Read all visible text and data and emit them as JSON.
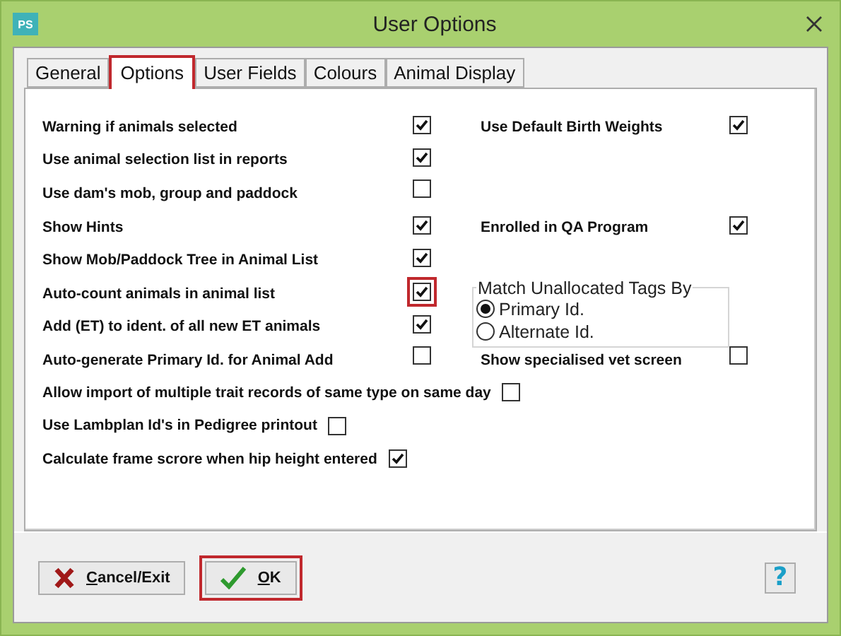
{
  "window": {
    "title": "User Options",
    "app_icon": "PS"
  },
  "tabs": [
    {
      "label": "General",
      "selected": false,
      "highlighted": false
    },
    {
      "label": "Options",
      "selected": true,
      "highlighted": true
    },
    {
      "label": "User Fields",
      "selected": false,
      "highlighted": false
    },
    {
      "label": "Colours",
      "selected": false,
      "highlighted": false
    },
    {
      "label": "Animal Display",
      "selected": false,
      "highlighted": false
    }
  ],
  "options": [
    {
      "kind": "left",
      "label": "Warning if animals selected",
      "checked": true,
      "highlighted": false
    },
    {
      "kind": "right",
      "label": "Use Default Birth Weights",
      "checked": true,
      "highlighted": false
    },
    {
      "kind": "left",
      "label": "Use animal selection list in reports",
      "checked": true,
      "highlighted": false
    },
    {
      "kind": "left",
      "label": "Use dam's mob, group and paddock",
      "checked": false,
      "highlighted": false
    },
    {
      "kind": "left",
      "label": "Show Hints",
      "checked": true,
      "highlighted": false
    },
    {
      "kind": "right",
      "label": "Enrolled in QA Program",
      "checked": true,
      "highlighted": false
    },
    {
      "kind": "left",
      "label": "Show Mob/Paddock Tree in Animal List",
      "checked": true,
      "highlighted": false
    },
    {
      "kind": "left",
      "label": "Auto-count animals in animal list",
      "checked": true,
      "highlighted": true
    },
    {
      "kind": "left",
      "label": "Add (ET) to ident. of all new ET animals",
      "checked": true,
      "highlighted": false
    },
    {
      "kind": "left",
      "label": "Auto-generate Primary Id. for Animal Add",
      "checked": false,
      "highlighted": false
    },
    {
      "kind": "right",
      "label": "Show specialised vet screen",
      "checked": false,
      "highlighted": false
    },
    {
      "kind": "wide",
      "label": "Allow import of multiple trait records of same type on same day",
      "checked": false,
      "highlighted": false
    },
    {
      "kind": "wide",
      "label": "Use Lambplan Id's in Pedigree printout",
      "checked": false,
      "highlighted": false
    },
    {
      "kind": "wide",
      "label": "Calculate frame scrore when hip height entered",
      "checked": true,
      "highlighted": false
    }
  ],
  "match_group": {
    "title": "Match Unallocated Tags By",
    "choices": [
      {
        "label": "Primary Id.",
        "selected": true
      },
      {
        "label": "Alternate Id.",
        "selected": false
      }
    ]
  },
  "buttons": [
    {
      "kind": "cancel",
      "label": "Cancel/Exit",
      "highlighted": false
    },
    {
      "kind": "ok",
      "label": "OK",
      "highlighted": true
    }
  ],
  "help_button": {
    "label": "?"
  }
}
